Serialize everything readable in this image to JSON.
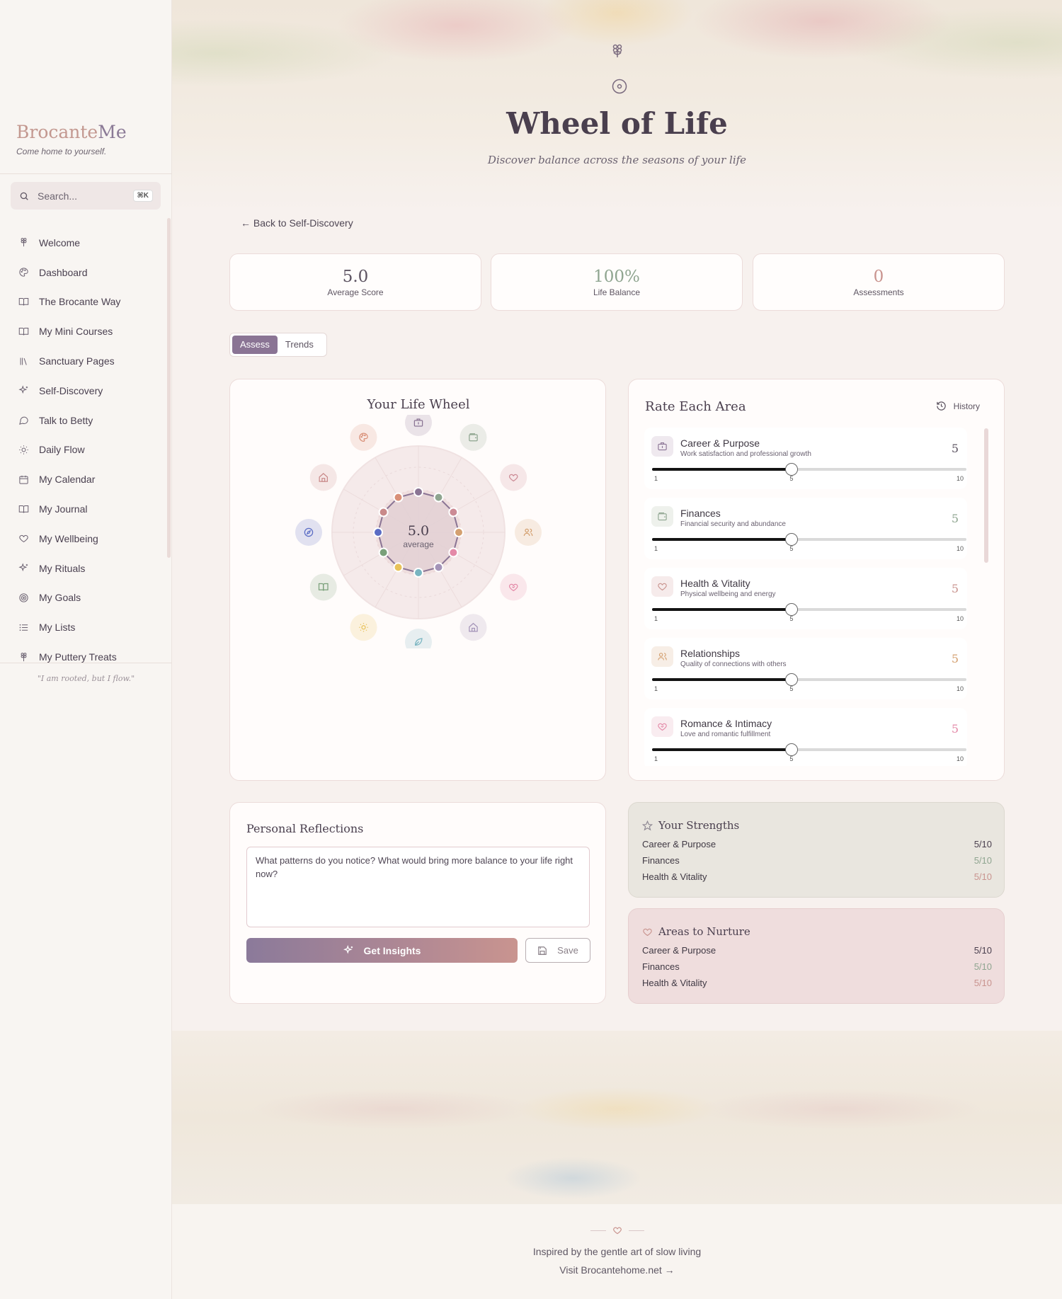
{
  "sidebar": {
    "brand_part1": "Brocante",
    "brand_part2": "Me",
    "tagline": "Come home to yourself.",
    "search_placeholder": "Search...",
    "search_shortcut": "⌘K",
    "quote": "\"I am rooted, but I flow.\"",
    "items": [
      {
        "label": "Welcome",
        "icon": "flower-icon"
      },
      {
        "label": "Dashboard",
        "icon": "palette-icon"
      },
      {
        "label": "The Brocante Way",
        "icon": "book-icon"
      },
      {
        "label": "My Mini Courses",
        "icon": "book-icon"
      },
      {
        "label": "Sanctuary Pages",
        "icon": "library-icon"
      },
      {
        "label": "Self-Discovery",
        "icon": "sparkles-icon"
      },
      {
        "label": "Talk to Betty",
        "icon": "chat-icon"
      },
      {
        "label": "Daily Flow",
        "icon": "sun-icon"
      },
      {
        "label": "My Calendar",
        "icon": "calendar-icon"
      },
      {
        "label": "My Journal",
        "icon": "book-icon"
      },
      {
        "label": "My Wellbeing",
        "icon": "heart-icon"
      },
      {
        "label": "My Rituals",
        "icon": "sparkles-icon"
      },
      {
        "label": "My Goals",
        "icon": "target-icon"
      },
      {
        "label": "My Lists",
        "icon": "list-icon"
      },
      {
        "label": "My Puttery Treats",
        "icon": "flower-icon"
      }
    ]
  },
  "header": {
    "title": "Wheel of Life",
    "subtitle": "Discover balance across the seasons of your life",
    "back_link": "← Back to Self-Discovery"
  },
  "stats": [
    {
      "value": "5.0",
      "label": "Average Score",
      "color": "#5d5462"
    },
    {
      "value": "100%",
      "label": "Life Balance",
      "color": "#8fa590"
    },
    {
      "value": "0",
      "label": "Assessments",
      "color": "#c9948f"
    }
  ],
  "tabs": {
    "assess": "Assess",
    "trends": "Trends"
  },
  "wheel": {
    "title": "Your Life Wheel",
    "center_value": "5.0",
    "center_label": "average",
    "areas": [
      {
        "icon": "briefcase-icon",
        "color": "#8a7494",
        "score": 5
      },
      {
        "icon": "wallet-icon",
        "color": "#8fa590",
        "score": 5
      },
      {
        "icon": "heart-icon",
        "color": "#cc8b95",
        "score": 5
      },
      {
        "icon": "users-icon",
        "color": "#d4a070",
        "score": 5
      },
      {
        "icon": "heart-handshake-icon",
        "color": "#e48aa8",
        "score": 5
      },
      {
        "icon": "home-icon",
        "color": "#a494b8",
        "score": 5
      },
      {
        "icon": "leaf-icon",
        "color": "#78b4c0",
        "score": 5
      },
      {
        "icon": "sun-icon",
        "color": "#e8c25a",
        "score": 5
      },
      {
        "icon": "book-open-icon",
        "color": "#7aa07a",
        "score": 5
      },
      {
        "icon": "compass-icon",
        "color": "#5a6cc4",
        "score": 5
      },
      {
        "icon": "home-icon",
        "color": "#c98a8a",
        "score": 5
      },
      {
        "icon": "palette-icon",
        "color": "#d99078",
        "score": 5
      }
    ]
  },
  "rate": {
    "title": "Rate Each Area",
    "history_label": "History",
    "min_label": "1",
    "mid_label": "5",
    "max_label": "10",
    "items": [
      {
        "name": "Career & Purpose",
        "desc": "Work satisfaction and professional growth",
        "value": "5",
        "score": 5,
        "color": "#5d5462",
        "icon_bg": "#efe9ef",
        "icon_color": "#8a7494"
      },
      {
        "name": "Finances",
        "desc": "Financial security and abundance",
        "value": "5",
        "score": 5,
        "color": "#8fa590",
        "icon_bg": "#eef1ec",
        "icon_color": "#8fa590"
      },
      {
        "name": "Health & Vitality",
        "desc": "Physical wellbeing and energy",
        "value": "5",
        "score": 5,
        "color": "#c9948f",
        "icon_bg": "#f6ebeb",
        "icon_color": "#c9948f"
      },
      {
        "name": "Relationships",
        "desc": "Quality of connections with others",
        "value": "5",
        "score": 5,
        "color": "#d4a070",
        "icon_bg": "#f7eee6",
        "icon_color": "#d4a070"
      },
      {
        "name": "Romance & Intimacy",
        "desc": "Love and romantic fulfillment",
        "value": "5",
        "score": 5,
        "color": "#e48aa8",
        "icon_bg": "#f9ecf0",
        "icon_color": "#e48aa8"
      }
    ]
  },
  "reflections": {
    "title": "Personal Reflections",
    "placeholder": "What patterns do you notice? What would bring more balance to your life right now?",
    "insights_label": "Get Insights",
    "save_label": "Save"
  },
  "strengths": {
    "title": "Your Strengths",
    "items": [
      {
        "name": "Career & Purpose",
        "value": "5/10",
        "color": "#4a3f4e"
      },
      {
        "name": "Finances",
        "value": "5/10",
        "color": "#8fa590"
      },
      {
        "name": "Health & Vitality",
        "value": "5/10",
        "color": "#c9948f"
      }
    ]
  },
  "nurture": {
    "title": "Areas to Nurture",
    "items": [
      {
        "name": "Career & Purpose",
        "value": "5/10",
        "color": "#4a3f4e"
      },
      {
        "name": "Finances",
        "value": "5/10",
        "color": "#8fa590"
      },
      {
        "name": "Health & Vitality",
        "value": "5/10",
        "color": "#c9948f"
      }
    ]
  },
  "footer": {
    "line1": "Inspired by the gentle art of slow living",
    "line2": "Visit Brocantehome.net →"
  }
}
